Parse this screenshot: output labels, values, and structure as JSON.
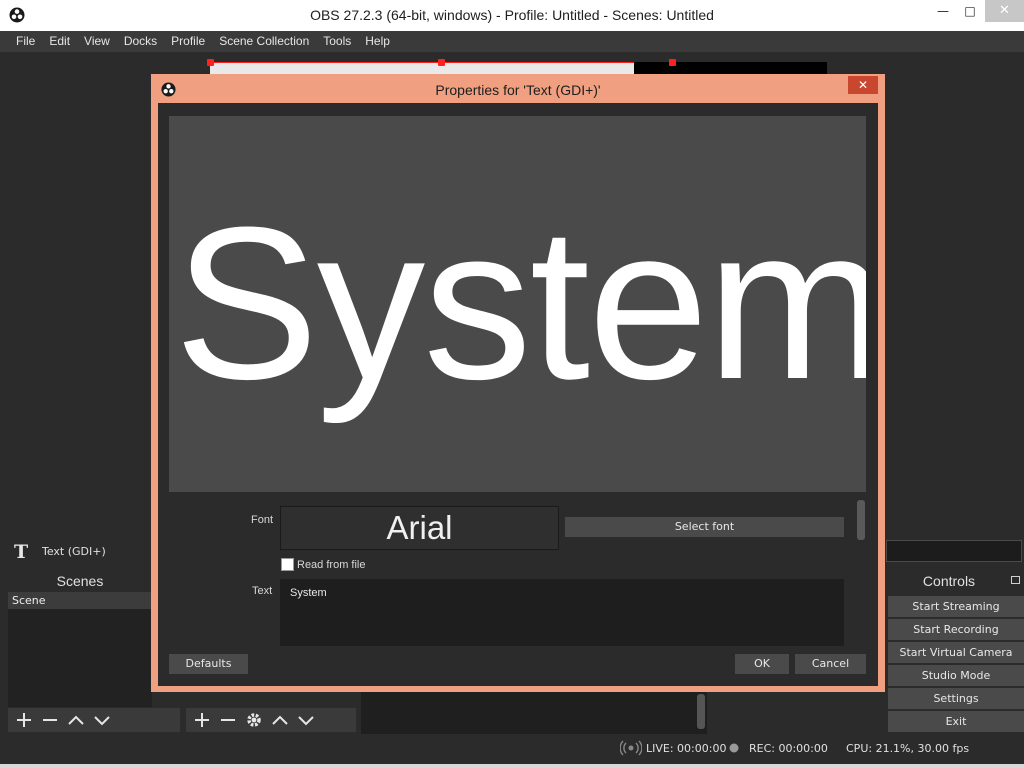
{
  "window": {
    "title": "OBS 27.2.3 (64-bit, windows) - Profile: Untitled - Scenes: Untitled",
    "min_glyph": "—",
    "max_glyph": "□",
    "close_glyph": "✕"
  },
  "menu": [
    "File",
    "Edit",
    "View",
    "Docks",
    "Profile",
    "Scene Collection",
    "Tools",
    "Help"
  ],
  "sources": {
    "icon_glyph": "T",
    "item_label": "Text (GDI+)"
  },
  "scenes": {
    "title": "Scenes",
    "items": [
      "Scene"
    ]
  },
  "controls": {
    "title": "Controls",
    "buttons": [
      "Start Streaming",
      "Start Recording",
      "Start Virtual Camera",
      "Studio Mode",
      "Settings",
      "Exit"
    ]
  },
  "status": {
    "live": "LIVE: 00:00:00",
    "rec": "REC: 00:00:00",
    "cpu": "CPU: 21.1%, 30.00 fps"
  },
  "dialog": {
    "title": "Properties for 'Text (GDI+)'",
    "close_glyph": "✕",
    "preview_text": "System",
    "font_label": "Font",
    "font_value": "Arial",
    "select_font_label": "Select font",
    "read_from_file_label": "Read from file",
    "read_from_file_checked": false,
    "text_label": "Text",
    "text_value": "System",
    "defaults_label": "Defaults",
    "ok_label": "OK",
    "cancel_label": "Cancel"
  },
  "colors": {
    "dialog_border": "#f0a080",
    "selection_red": "#ff2020",
    "close_red": "#c9472f"
  }
}
